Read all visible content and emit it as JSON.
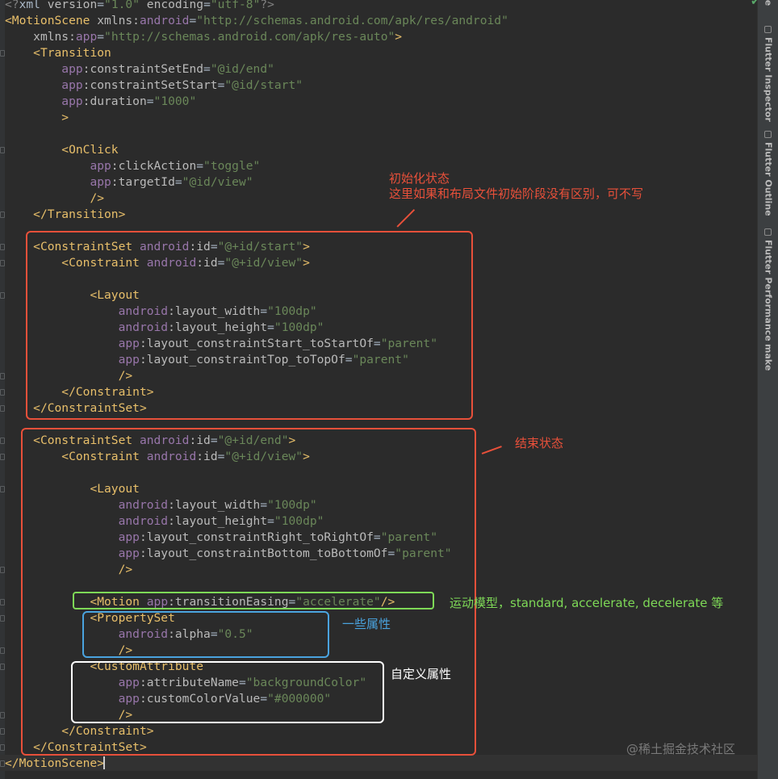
{
  "editor": {
    "lines": [
      [
        [
          "d",
          "<?"
        ],
        [
          "x",
          "xml "
        ],
        [
          "a",
          "version"
        ],
        [
          "x",
          "="
        ],
        [
          "v",
          "\"1.0\""
        ],
        [
          "x",
          " "
        ],
        [
          "a",
          "encoding"
        ],
        [
          "x",
          "="
        ],
        [
          "v",
          "\"utf-8\""
        ],
        [
          "d",
          "?>"
        ]
      ],
      [
        [
          "t",
          "<MotionScene"
        ],
        [
          "x",
          " "
        ],
        [
          "a",
          "xmlns:"
        ],
        [
          "n",
          "android"
        ],
        [
          "x",
          "="
        ],
        [
          "v",
          "\"http://schemas.android.com/apk/res/android\""
        ]
      ],
      [
        [
          "x",
          "    "
        ],
        [
          "a",
          "xmlns:"
        ],
        [
          "n",
          "app"
        ],
        [
          "x",
          "="
        ],
        [
          "v",
          "\"http://schemas.android.com/apk/res-auto\""
        ],
        [
          "t",
          ">"
        ]
      ],
      [
        [
          "x",
          "    "
        ],
        [
          "t",
          "<Transition"
        ]
      ],
      [
        [
          "x",
          "        "
        ],
        [
          "n",
          "app"
        ],
        [
          "a",
          ":constraintSetEnd"
        ],
        [
          "x",
          "="
        ],
        [
          "v",
          "\"@id/end\""
        ]
      ],
      [
        [
          "x",
          "        "
        ],
        [
          "n",
          "app"
        ],
        [
          "a",
          ":constraintSetStart"
        ],
        [
          "x",
          "="
        ],
        [
          "v",
          "\"@id/start\""
        ]
      ],
      [
        [
          "x",
          "        "
        ],
        [
          "n",
          "app"
        ],
        [
          "a",
          ":duration"
        ],
        [
          "x",
          "="
        ],
        [
          "v",
          "\"1000\""
        ]
      ],
      [
        [
          "x",
          "        "
        ],
        [
          "t",
          ">"
        ]
      ],
      [],
      [
        [
          "x",
          "        "
        ],
        [
          "t",
          "<OnClick"
        ]
      ],
      [
        [
          "x",
          "            "
        ],
        [
          "n",
          "app"
        ],
        [
          "a",
          ":clickAction"
        ],
        [
          "x",
          "="
        ],
        [
          "v",
          "\"toggle\""
        ]
      ],
      [
        [
          "x",
          "            "
        ],
        [
          "n",
          "app"
        ],
        [
          "a",
          ":targetId"
        ],
        [
          "x",
          "="
        ],
        [
          "v",
          "\"@id/view\""
        ]
      ],
      [
        [
          "x",
          "            "
        ],
        [
          "t",
          "/>"
        ]
      ],
      [
        [
          "x",
          "    "
        ],
        [
          "t",
          "</Transition>"
        ]
      ],
      [],
      [
        [
          "x",
          "    "
        ],
        [
          "t",
          "<ConstraintSet"
        ],
        [
          "x",
          " "
        ],
        [
          "n",
          "android"
        ],
        [
          "a",
          ":id"
        ],
        [
          "x",
          "="
        ],
        [
          "v",
          "\"@+id/start\""
        ],
        [
          "t",
          ">"
        ]
      ],
      [
        [
          "x",
          "        "
        ],
        [
          "t",
          "<Constraint"
        ],
        [
          "x",
          " "
        ],
        [
          "n",
          "android"
        ],
        [
          "a",
          ":id"
        ],
        [
          "x",
          "="
        ],
        [
          "v",
          "\"@+id/view\""
        ],
        [
          "t",
          ">"
        ]
      ],
      [],
      [
        [
          "x",
          "            "
        ],
        [
          "t",
          "<Layout"
        ]
      ],
      [
        [
          "x",
          "                "
        ],
        [
          "n",
          "android"
        ],
        [
          "a",
          ":layout_width"
        ],
        [
          "x",
          "="
        ],
        [
          "v",
          "\"100dp\""
        ]
      ],
      [
        [
          "x",
          "                "
        ],
        [
          "n",
          "android"
        ],
        [
          "a",
          ":layout_height"
        ],
        [
          "x",
          "="
        ],
        [
          "v",
          "\"100dp\""
        ]
      ],
      [
        [
          "x",
          "                "
        ],
        [
          "n",
          "app"
        ],
        [
          "a",
          ":layout_constraintStart_toStartOf"
        ],
        [
          "x",
          "="
        ],
        [
          "v",
          "\"parent\""
        ]
      ],
      [
        [
          "x",
          "                "
        ],
        [
          "n",
          "app"
        ],
        [
          "a",
          ":layout_constraintTop_toTopOf"
        ],
        [
          "x",
          "="
        ],
        [
          "v",
          "\"parent\""
        ]
      ],
      [
        [
          "x",
          "                "
        ],
        [
          "t",
          "/>"
        ]
      ],
      [
        [
          "x",
          "        "
        ],
        [
          "t",
          "</Constraint>"
        ]
      ],
      [
        [
          "x",
          "    "
        ],
        [
          "t",
          "</ConstraintSet>"
        ]
      ],
      [],
      [
        [
          "x",
          "    "
        ],
        [
          "t",
          "<ConstraintSet"
        ],
        [
          "x",
          " "
        ],
        [
          "n",
          "android"
        ],
        [
          "a",
          ":id"
        ],
        [
          "x",
          "="
        ],
        [
          "v",
          "\"@+id/end\""
        ],
        [
          "t",
          ">"
        ]
      ],
      [
        [
          "x",
          "        "
        ],
        [
          "t",
          "<Constraint"
        ],
        [
          "x",
          " "
        ],
        [
          "n",
          "android"
        ],
        [
          "a",
          ":id"
        ],
        [
          "x",
          "="
        ],
        [
          "v",
          "\"@+id/view\""
        ],
        [
          "t",
          ">"
        ]
      ],
      [],
      [
        [
          "x",
          "            "
        ],
        [
          "t",
          "<Layout"
        ]
      ],
      [
        [
          "x",
          "                "
        ],
        [
          "n",
          "android"
        ],
        [
          "a",
          ":layout_width"
        ],
        [
          "x",
          "="
        ],
        [
          "v",
          "\"100dp\""
        ]
      ],
      [
        [
          "x",
          "                "
        ],
        [
          "n",
          "android"
        ],
        [
          "a",
          ":layout_height"
        ],
        [
          "x",
          "="
        ],
        [
          "v",
          "\"100dp\""
        ]
      ],
      [
        [
          "x",
          "                "
        ],
        [
          "n",
          "app"
        ],
        [
          "a",
          ":layout_constraintRight_toRightOf"
        ],
        [
          "x",
          "="
        ],
        [
          "v",
          "\"parent\""
        ]
      ],
      [
        [
          "x",
          "                "
        ],
        [
          "n",
          "app"
        ],
        [
          "a",
          ":layout_constraintBottom_toBottomOf"
        ],
        [
          "x",
          "="
        ],
        [
          "v",
          "\"parent\""
        ]
      ],
      [
        [
          "x",
          "                "
        ],
        [
          "t",
          "/>"
        ]
      ],
      [],
      [
        [
          "x",
          "            "
        ],
        [
          "t",
          "<Motion"
        ],
        [
          "x",
          " "
        ],
        [
          "n",
          "app"
        ],
        [
          "a",
          ":transitionEasing"
        ],
        [
          "x",
          "="
        ],
        [
          "v",
          "\"accelerate\""
        ],
        [
          "t",
          "/>"
        ]
      ],
      [
        [
          "x",
          "            "
        ],
        [
          "t",
          "<PropertySet"
        ]
      ],
      [
        [
          "x",
          "                "
        ],
        [
          "n",
          "android"
        ],
        [
          "a",
          ":alpha"
        ],
        [
          "x",
          "="
        ],
        [
          "v",
          "\"0.5\""
        ]
      ],
      [
        [
          "x",
          "                "
        ],
        [
          "t",
          "/>"
        ]
      ],
      [
        [
          "x",
          "            "
        ],
        [
          "t",
          "<CustomAttribute"
        ]
      ],
      [
        [
          "x",
          "                "
        ],
        [
          "n",
          "app"
        ],
        [
          "a",
          ":attributeName"
        ],
        [
          "x",
          "="
        ],
        [
          "v",
          "\"backgroundColor\""
        ]
      ],
      [
        [
          "x",
          "                "
        ],
        [
          "n",
          "app"
        ],
        [
          "a",
          ":customColorValue"
        ],
        [
          "x",
          "="
        ],
        [
          "v",
          "\"#000000\""
        ]
      ],
      [
        [
          "x",
          "                "
        ],
        [
          "t",
          "/>"
        ]
      ],
      [
        [
          "x",
          "        "
        ],
        [
          "t",
          "</Constraint>"
        ]
      ],
      [
        [
          "x",
          "    "
        ],
        [
          "t",
          "</ConstraintSet>"
        ]
      ],
      [
        [
          "t",
          "</MotionScene>"
        ]
      ]
    ]
  },
  "right_panel": {
    "top_label": "le",
    "tabs": [
      "Flutter Inspector",
      "Flutter Outline",
      "Flutter Performance",
      "make"
    ]
  },
  "annotations": {
    "start_title": "初始化状态",
    "start_desc": "这里如果和布局文件初始阶段没有区别，可不写",
    "end_title": "结束状态",
    "motion_note": "运动模型，standard, accelerate, decelerate 等",
    "property_note": "一些属性",
    "custom_note": "自定义属性"
  },
  "watermark": "@稀土掘金技术社区",
  "colors": {
    "tag": "#e8bf6a",
    "attribute": "#bababa",
    "namespace": "#9876aa",
    "string": "#6a8759",
    "red_box": "#e8503a",
    "green_box": "#7ed957",
    "blue_box": "#4aa3df",
    "white_box": "#ffffff"
  }
}
